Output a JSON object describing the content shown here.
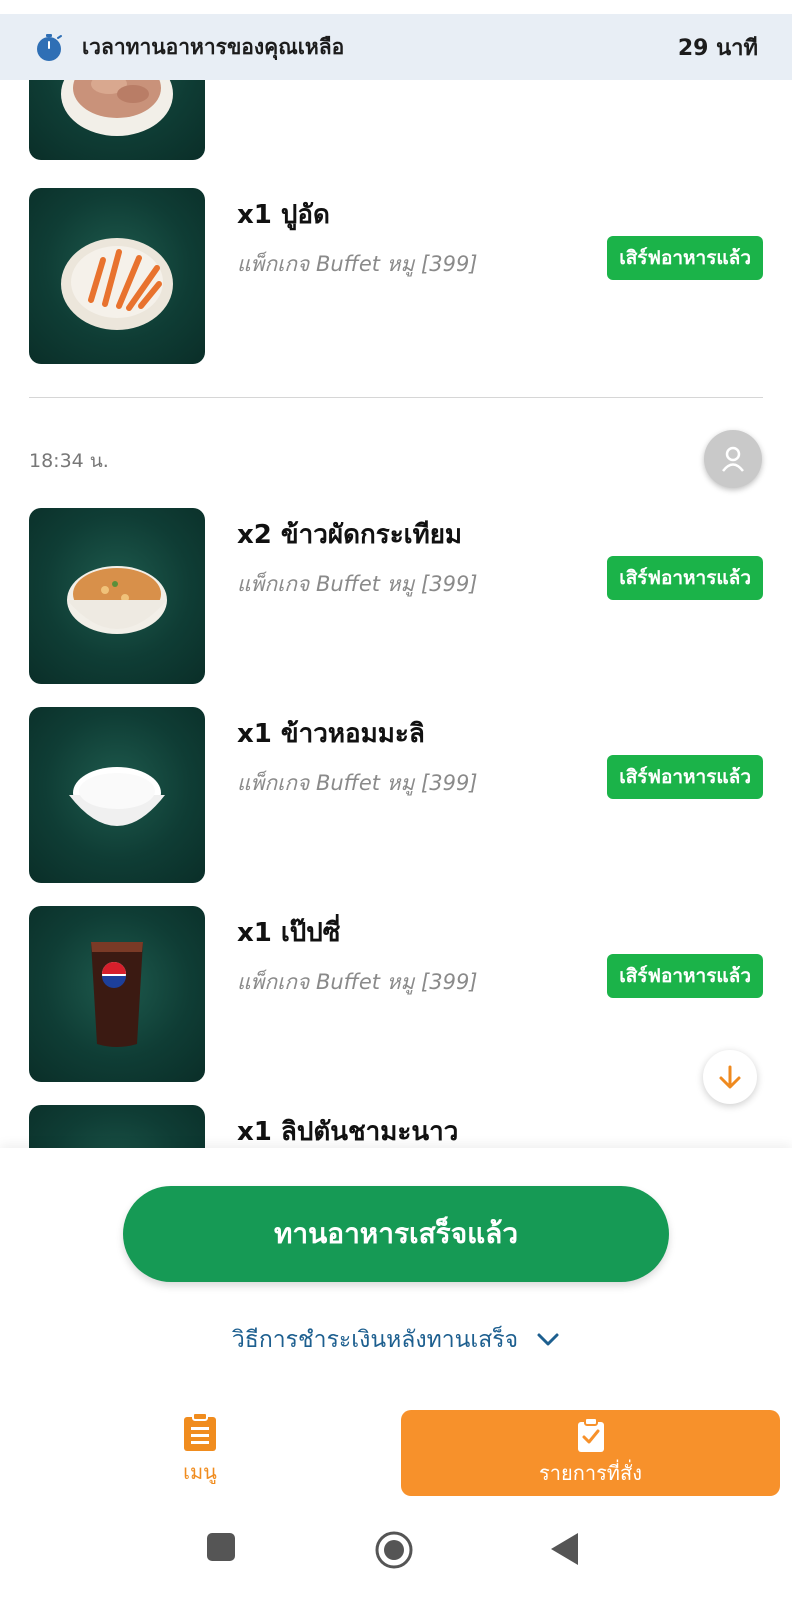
{
  "timer": {
    "label": "เวลาทานอาหารของคุณเหลือ",
    "value": "29 นาที",
    "icon": "stopwatch-icon"
  },
  "orders": {
    "group_1": {
      "items": [
        {
          "title": "x1 ปูอัด",
          "package": "แพ็กเกจ Buffet หมู [399]",
          "status": "เสิร์ฟอาหารแล้ว"
        }
      ]
    },
    "group_2": {
      "time": "18:34 น.",
      "items": [
        {
          "title": "x2 ข้าวผัดกระเทียม",
          "package": "แพ็กเกจ Buffet หมู [399]",
          "status": "เสิร์ฟอาหารแล้ว"
        },
        {
          "title": "x1 ข้าวหอมมะลิ",
          "package": "แพ็กเกจ Buffet หมู [399]",
          "status": "เสิร์ฟอาหารแล้ว"
        },
        {
          "title": "x1 เป๊ปซี่",
          "package": "แพ็กเกจ Buffet หมู [399]",
          "status": "เสิร์ฟอาหารแล้ว"
        },
        {
          "title": "x1 ลิปตันชามะนาว"
        }
      ]
    }
  },
  "actions": {
    "finish_label": "ทานอาหารเสร็จแล้ว",
    "payment_label": "วิธีการชำระเงินหลังทานเสร็จ"
  },
  "nav": {
    "menu_label": "เมนู",
    "orders_label": "รายการที่สั่ง"
  },
  "colors": {
    "accent_green": "#169a55",
    "badge_green": "#1bb349",
    "accent_orange": "#f7912b",
    "link_blue": "#1d5f8f"
  }
}
